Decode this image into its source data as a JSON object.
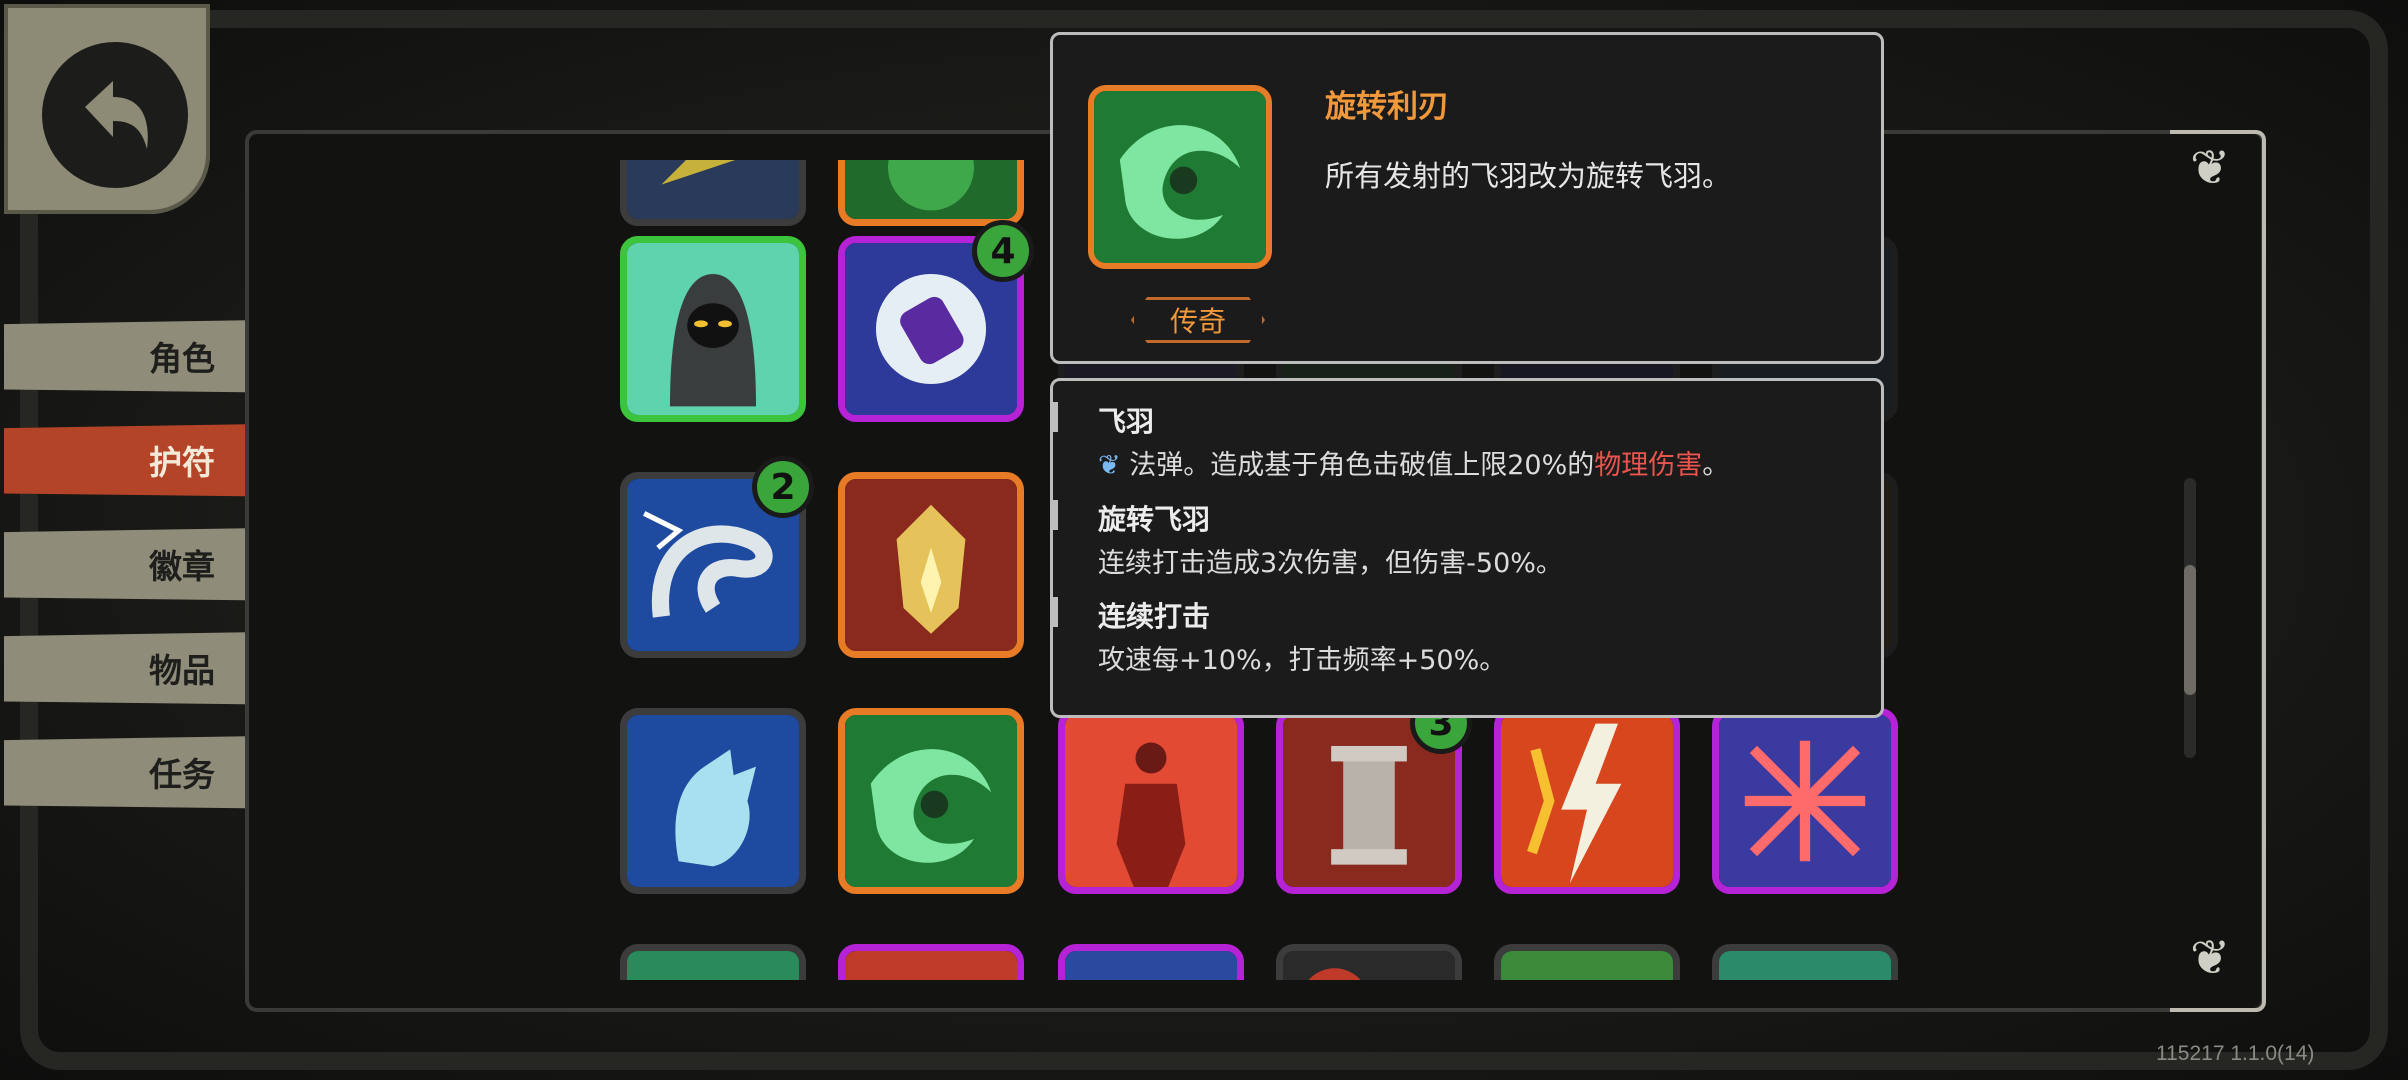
{
  "sidebar": {
    "tabs": [
      {
        "label": "角色",
        "active": false
      },
      {
        "label": "护符",
        "active": true
      },
      {
        "label": "徽章",
        "active": false
      },
      {
        "label": "物品",
        "active": false
      },
      {
        "label": "任务",
        "active": false
      }
    ]
  },
  "grid": {
    "badges": [
      "4",
      "2",
      "3"
    ]
  },
  "tooltip": {
    "title": "旋转利刃",
    "description": "所有发射的飞羽改为旋转飞羽。",
    "rarity": "传奇",
    "sections": [
      {
        "title": "飞羽",
        "text_before": "法弹。造成基于角色击破值上限20%的",
        "highlight": "物理伤害",
        "text_after": "。"
      },
      {
        "title": "旋转飞羽",
        "text": "连续打击造成3次伤害，但伤害-50%。"
      },
      {
        "title": "连续打击",
        "text": "攻速每+10%，打击频率+50%。"
      }
    ]
  },
  "version": "115217 1.1.0(14)",
  "colors": {
    "accent_orange": "#f0983a",
    "active_tab": "#b34428",
    "damage_red": "#e8554e"
  }
}
